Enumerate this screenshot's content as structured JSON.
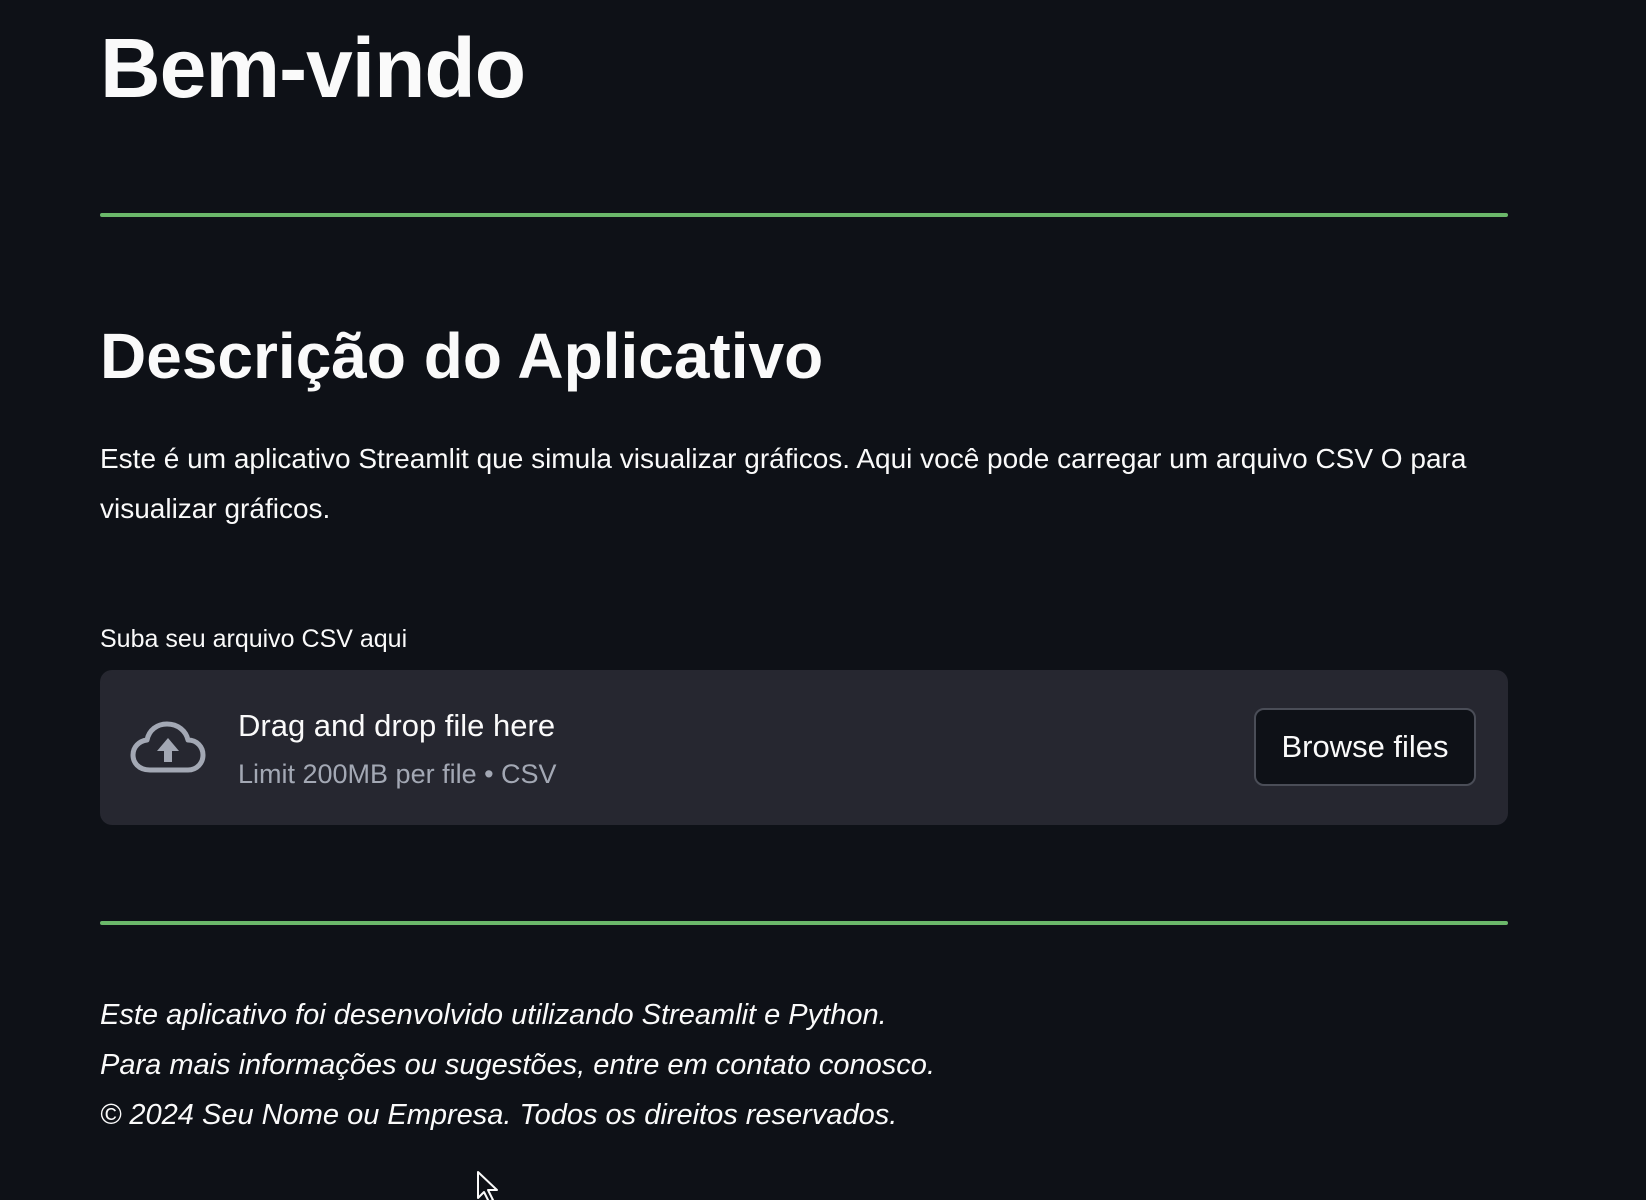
{
  "header": {
    "title": "Bem-vindo"
  },
  "description": {
    "heading": "Descrição do Aplicativo",
    "text": "Este é um aplicativo Streamlit que simula visualizar gráficos. Aqui você pode carregar um arquivo CSV O para visualizar gráficos."
  },
  "uploader": {
    "label": "Suba seu arquivo CSV aqui",
    "icon": "cloud-upload-icon",
    "drop_text": "Drag and drop file here",
    "limit_text": "Limit 200MB per file • CSV",
    "browse_label": "Browse files"
  },
  "footer": {
    "line1": "Este aplicativo foi desenvolvido utilizando Streamlit e Python.",
    "line2": "Para mais informações ou sugestões, entre em contato conosco.",
    "line3": "© 2024 Seu Nome ou Empresa. Todos os direitos reservados."
  },
  "colors": {
    "background": "#0e1117",
    "divider": "#6bb86a",
    "dropzone": "#262730",
    "text": "#fafafa",
    "muted": "#a3a8b4"
  }
}
